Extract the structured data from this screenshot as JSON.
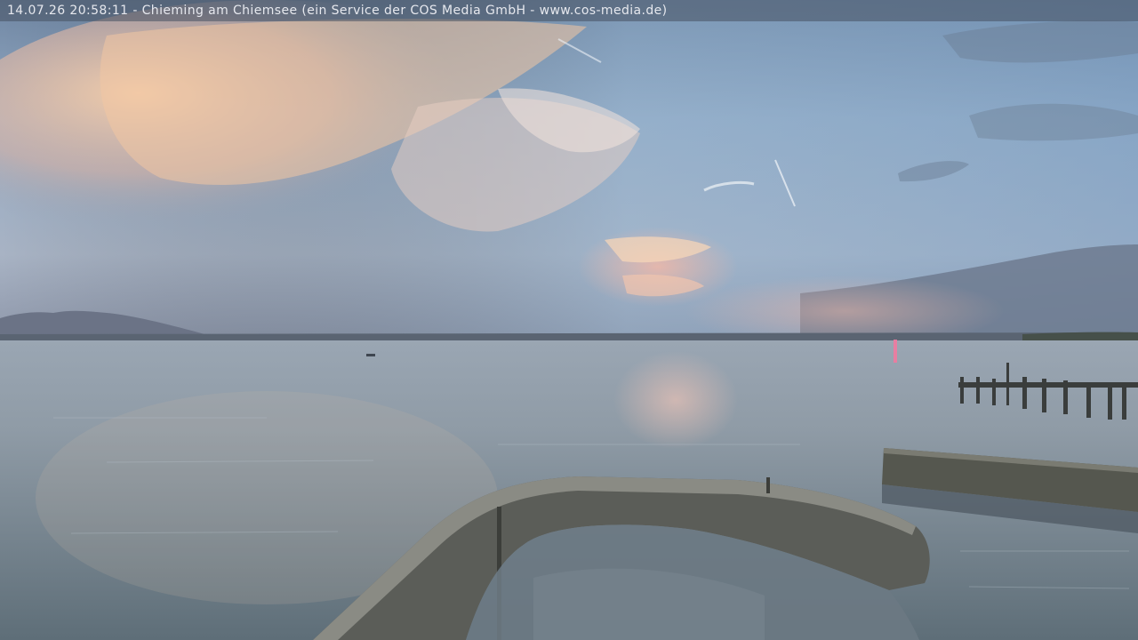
{
  "overlay": {
    "caption": "14.07.26 20:58:11 - Chieming am Chiemsee (ein Service der COS Media GmbH - www.cos-media.de)"
  },
  "colors": {
    "sky_top": "#5d7894",
    "sky_mid": "#8ea7c0",
    "cloud_glow": "#f4c9a4",
    "horizon_pink": "#e8a0a0",
    "water_light": "#a9b6bf",
    "water_dark": "#5f6f7c",
    "sun_reflection": "#f07aa0"
  }
}
